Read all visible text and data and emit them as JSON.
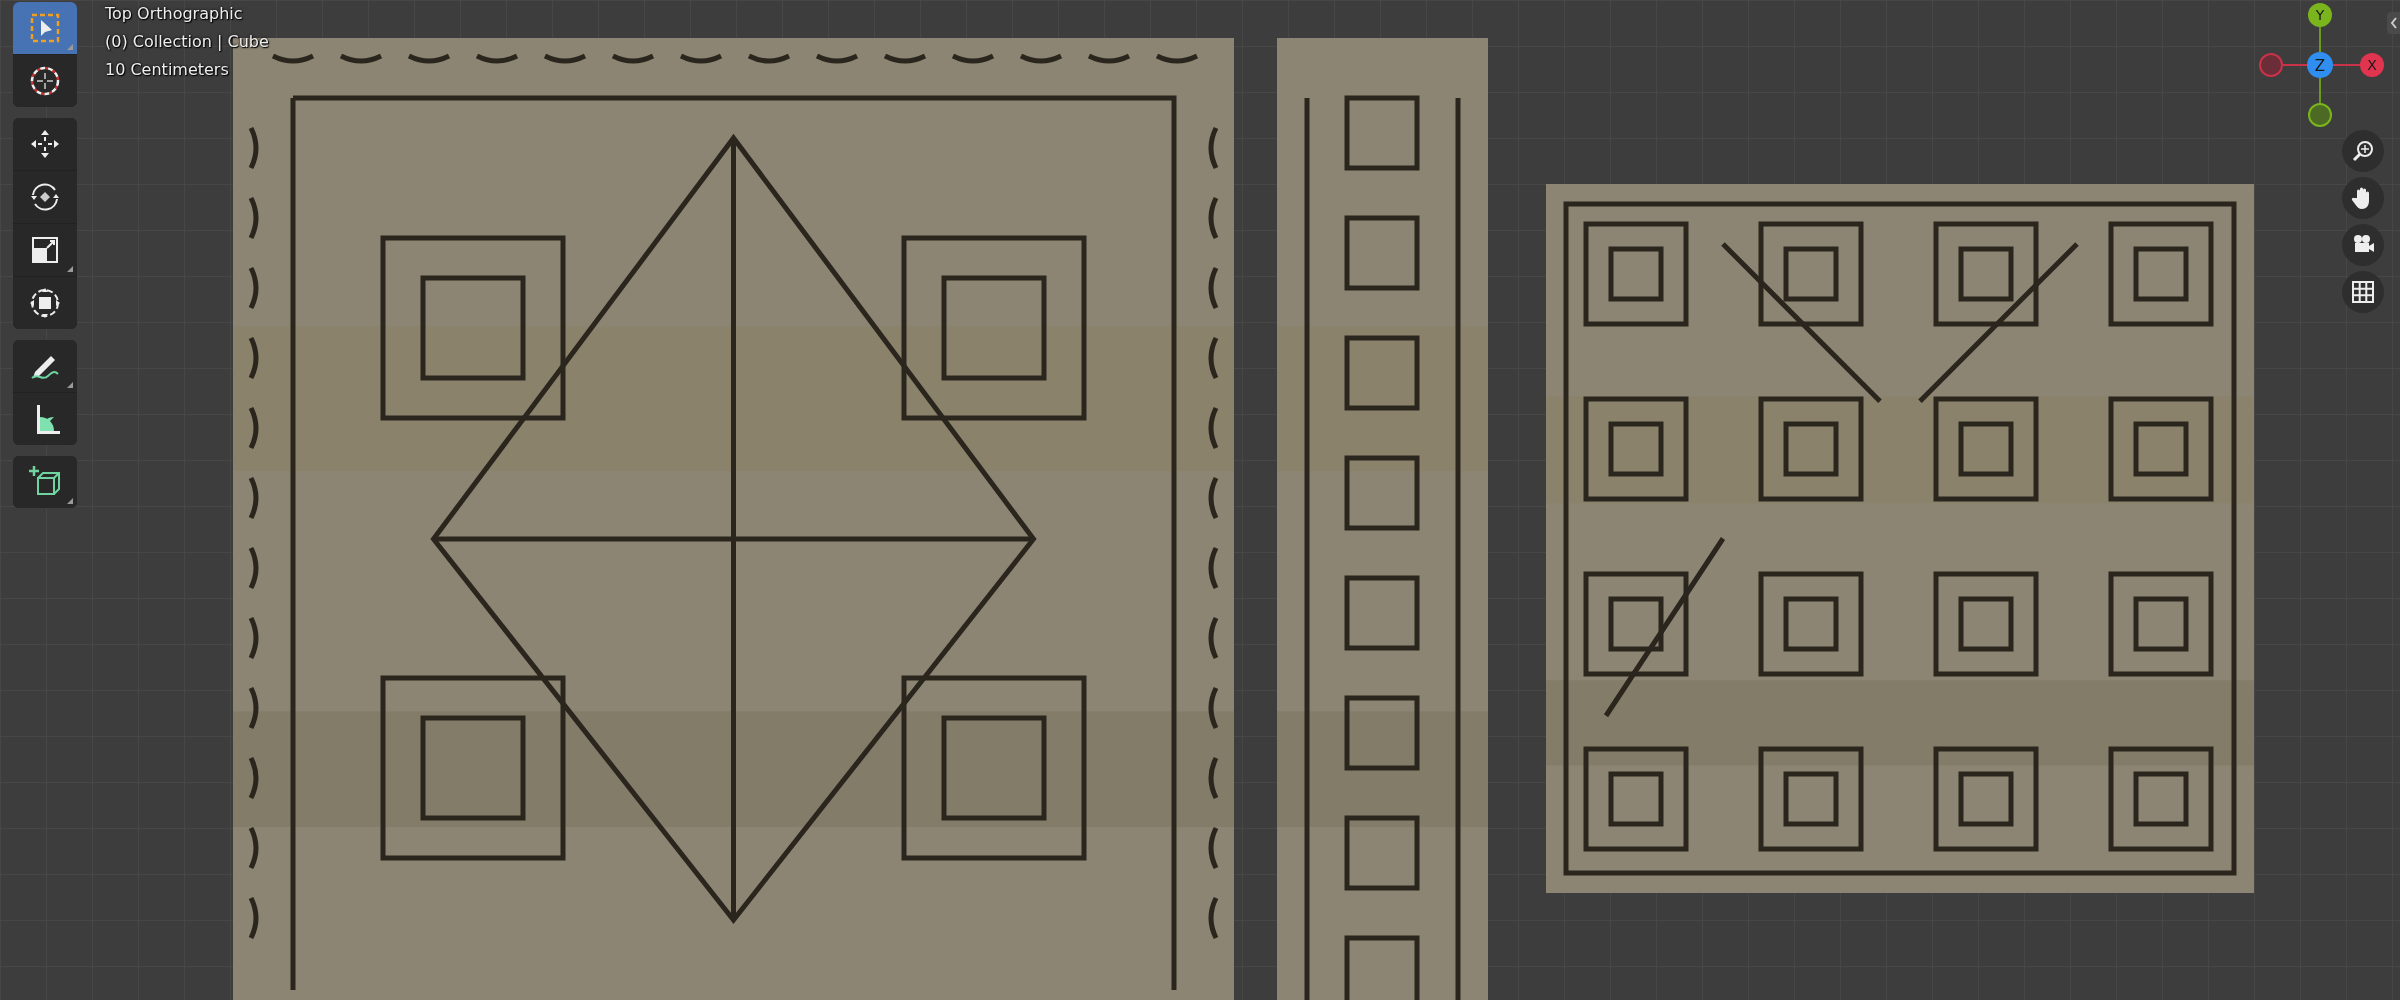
{
  "viewport_info": [
    "Top Orthographic",
    "(0) Collection | Cube",
    "10 Centimeters"
  ],
  "toolbar": [
    [
      {
        "kind": "select-box",
        "selected": true,
        "submenu": true
      },
      {
        "kind": "cursor",
        "selected": false,
        "submenu": false
      }
    ],
    [
      {
        "kind": "move",
        "selected": false,
        "submenu": false
      },
      {
        "kind": "rotate",
        "selected": false,
        "submenu": false
      },
      {
        "kind": "scale",
        "selected": false,
        "submenu": true
      },
      {
        "kind": "transform",
        "selected": false,
        "submenu": false
      }
    ],
    [
      {
        "kind": "annotate",
        "selected": false,
        "submenu": true
      },
      {
        "kind": "measure",
        "selected": false,
        "submenu": false
      }
    ],
    [
      {
        "kind": "add-cube",
        "selected": false,
        "submenu": true
      }
    ]
  ],
  "gizmo": {
    "y": "Y",
    "z": "Z",
    "x": "X"
  },
  "nav_buttons": [
    {
      "kind": "zoom"
    },
    {
      "kind": "pan"
    },
    {
      "kind": "camera"
    },
    {
      "kind": "grid"
    }
  ]
}
